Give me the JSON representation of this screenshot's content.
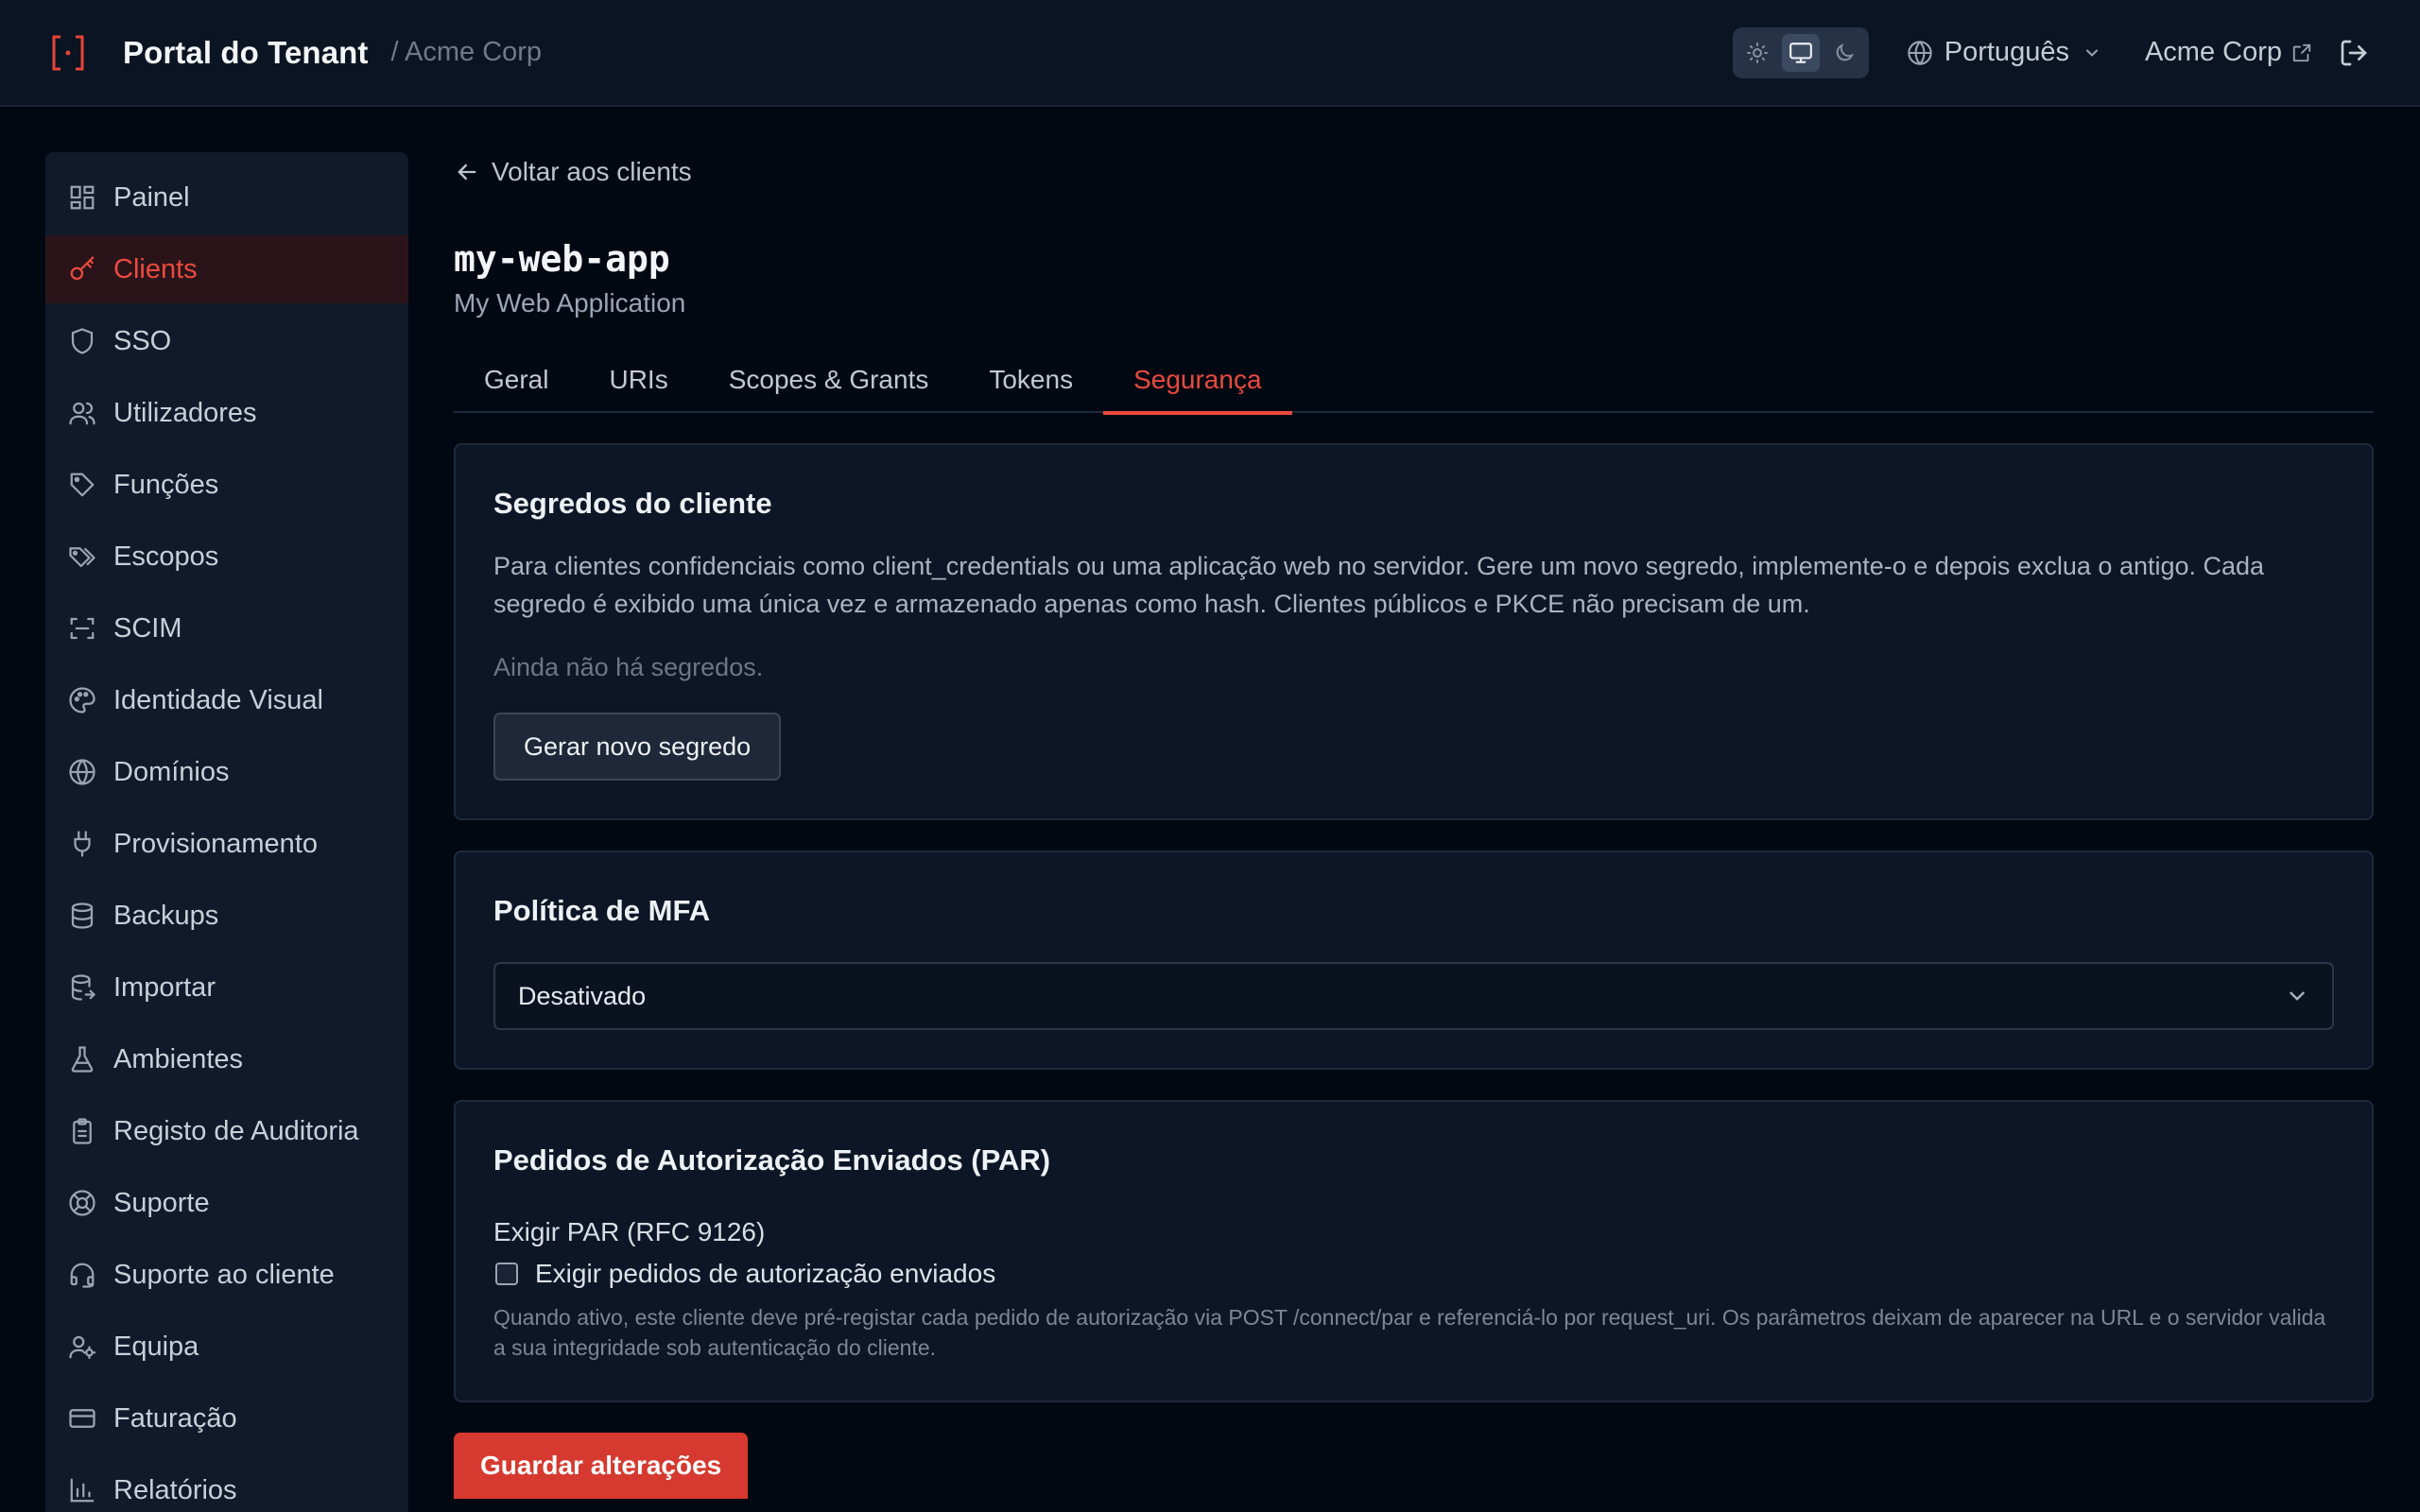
{
  "header": {
    "title": "Portal do Tenant",
    "tenant_crumb": "/ Acme Corp",
    "theme_options": [
      "light",
      "system",
      "dark"
    ],
    "theme_selected": "system",
    "language": "Português",
    "tenant_link": "Acme Corp"
  },
  "sidebar": {
    "items": [
      {
        "label": "Painel",
        "icon": "dashboard-icon"
      },
      {
        "label": "Clients",
        "icon": "key-icon",
        "active": true
      },
      {
        "label": "SSO",
        "icon": "shield-icon"
      },
      {
        "label": "Utilizadores",
        "icon": "users-icon"
      },
      {
        "label": "Funções",
        "icon": "tag-icon"
      },
      {
        "label": "Escopos",
        "icon": "tags-icon"
      },
      {
        "label": "SCIM",
        "icon": "scan-icon"
      },
      {
        "label": "Identidade Visual",
        "icon": "palette-icon"
      },
      {
        "label": "Domínios",
        "icon": "globe-icon"
      },
      {
        "label": "Provisionamento",
        "icon": "plug-icon"
      },
      {
        "label": "Backups",
        "icon": "database-icon"
      },
      {
        "label": "Importar",
        "icon": "database-import-icon"
      },
      {
        "label": "Ambientes",
        "icon": "flask-icon"
      },
      {
        "label": "Registo de Auditoria",
        "icon": "clipboard-icon"
      },
      {
        "label": "Suporte",
        "icon": "lifebuoy-icon"
      },
      {
        "label": "Suporte ao cliente",
        "icon": "headset-icon"
      },
      {
        "label": "Equipa",
        "icon": "user-cog-icon"
      },
      {
        "label": "Faturação",
        "icon": "credit-card-icon"
      },
      {
        "label": "Relatórios",
        "icon": "bar-chart-icon"
      }
    ]
  },
  "main": {
    "back_label": "Voltar aos clients",
    "client_id": "my-web-app",
    "client_name": "My Web Application",
    "tabs": [
      {
        "label": "Geral"
      },
      {
        "label": "URIs"
      },
      {
        "label": "Scopes & Grants"
      },
      {
        "label": "Tokens"
      },
      {
        "label": "Segurança",
        "active": true
      }
    ],
    "secrets": {
      "title": "Segredos do cliente",
      "description": "Para clientes confidenciais como client_credentials ou uma aplicação web no servidor. Gere um novo segredo, implemente-o e depois exclua o antigo. Cada segredo é exibido uma única vez e armazenado apenas como hash. Clientes públicos e PKCE não precisam de um.",
      "empty": "Ainda não há segredos.",
      "generate_button": "Gerar novo segredo"
    },
    "mfa": {
      "title": "Política de MFA",
      "selected": "Desativado"
    },
    "par": {
      "title": "Pedidos de Autorização Enviados (PAR)",
      "field_label": "Exigir PAR (RFC 9126)",
      "checkbox_label": "Exigir pedidos de autorização enviados",
      "checked": false,
      "help": "Quando ativo, este cliente deve pré-registar cada pedido de autorização via POST /connect/par e referenciá-lo por request_uri. Os parâmetros deixam de aparecer na URL e o servidor valida a sua integridade sob autenticação do cliente."
    },
    "save_button": "Guardar alterações"
  },
  "colors": {
    "accent": "#ea4a3f",
    "background": "#020812",
    "panel": "#0d1626"
  }
}
